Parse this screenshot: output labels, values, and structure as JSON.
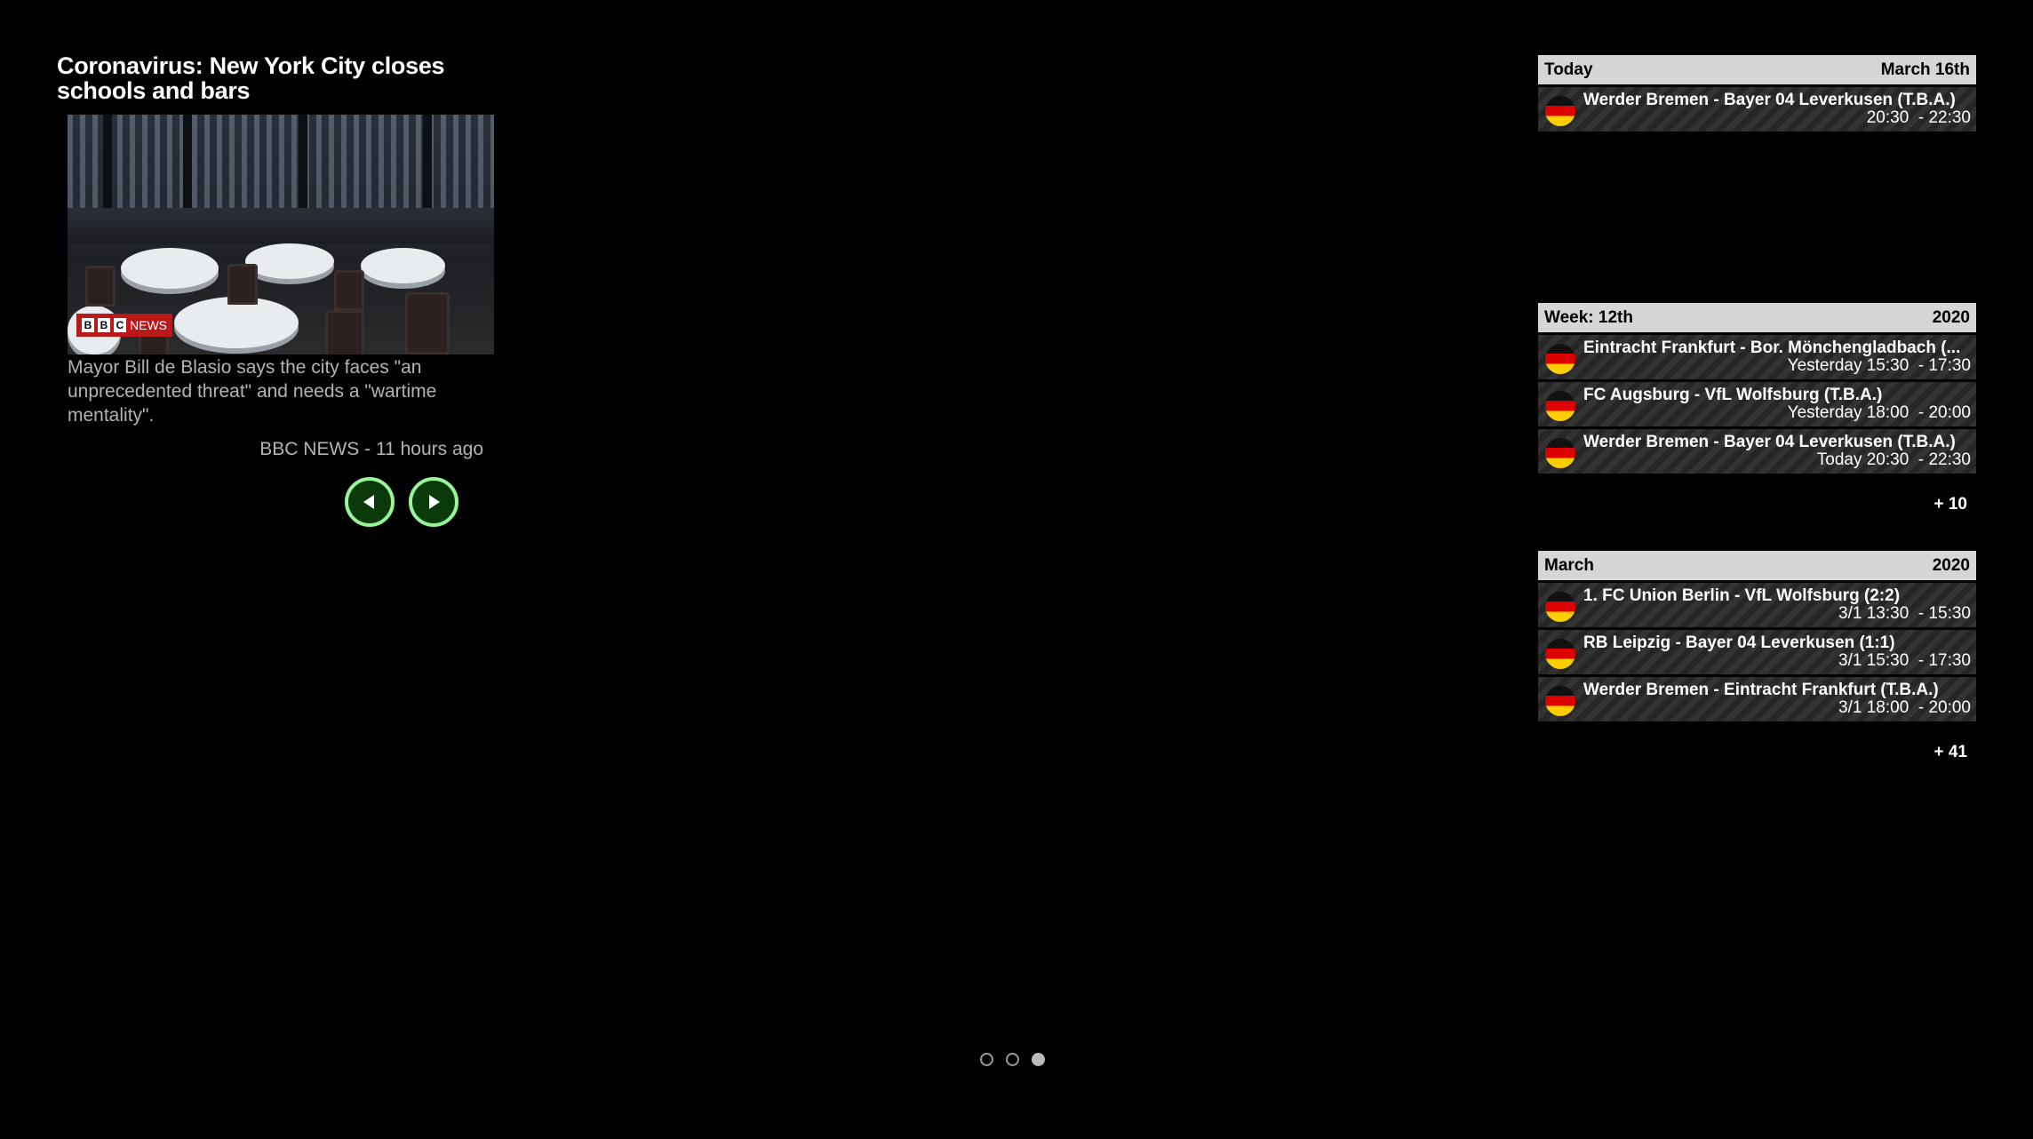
{
  "news": {
    "title": "Coronavirus: New York City closes schools and bars",
    "description": "Mayor Bill de Blasio says the city faces \"an unprecedented threat\" and needs a \"wartime mentality\".",
    "source_line": "BBC NEWS - 11 hours ago",
    "badge_text": "NEWS",
    "badge_letters": [
      "B",
      "B",
      "C"
    ],
    "prev_icon": "triangle-left-icon",
    "next_icon": "triangle-right-icon",
    "button_color": "#98f598"
  },
  "calendar": {
    "sections": [
      {
        "header_left": "Today",
        "header_right": "March 16th",
        "events": [
          {
            "title": "Werder Bremen - Bayer 04 Leverkusen (T.B.A.)",
            "time": "20:30  - 22:30",
            "flag": "germany-flag-icon"
          }
        ],
        "more": ""
      },
      {
        "header_left": "Week: 12th",
        "header_right": "2020",
        "events": [
          {
            "title": "Eintracht Frankfurt - Bor. Mönchengladbach (...",
            "time": "Yesterday 15:30  - 17:30",
            "flag": "germany-flag-icon"
          },
          {
            "title": "FC Augsburg - VfL Wolfsburg (T.B.A.)",
            "time": "Yesterday 18:00  - 20:00",
            "flag": "germany-flag-icon"
          },
          {
            "title": "Werder Bremen - Bayer 04 Leverkusen (T.B.A.)",
            "time": "Today 20:30  - 22:30",
            "flag": "germany-flag-icon"
          }
        ],
        "more": "+ 10"
      },
      {
        "header_left": "March",
        "header_right": "2020",
        "events": [
          {
            "title": "1. FC Union Berlin - VfL Wolfsburg (2:2)",
            "time": "3/1 13:30  - 15:30",
            "flag": "germany-flag-icon"
          },
          {
            "title": "RB Leipzig - Bayer 04 Leverkusen (1:1)",
            "time": "3/1 15:30  - 17:30",
            "flag": "germany-flag-icon"
          },
          {
            "title": "Werder Bremen - Eintracht Frankfurt (T.B.A.)",
            "time": "3/1 18:00  - 20:00",
            "flag": "germany-flag-icon"
          }
        ],
        "more": "+ 41"
      }
    ]
  },
  "pager": {
    "pages": 3,
    "active_index": 2
  }
}
